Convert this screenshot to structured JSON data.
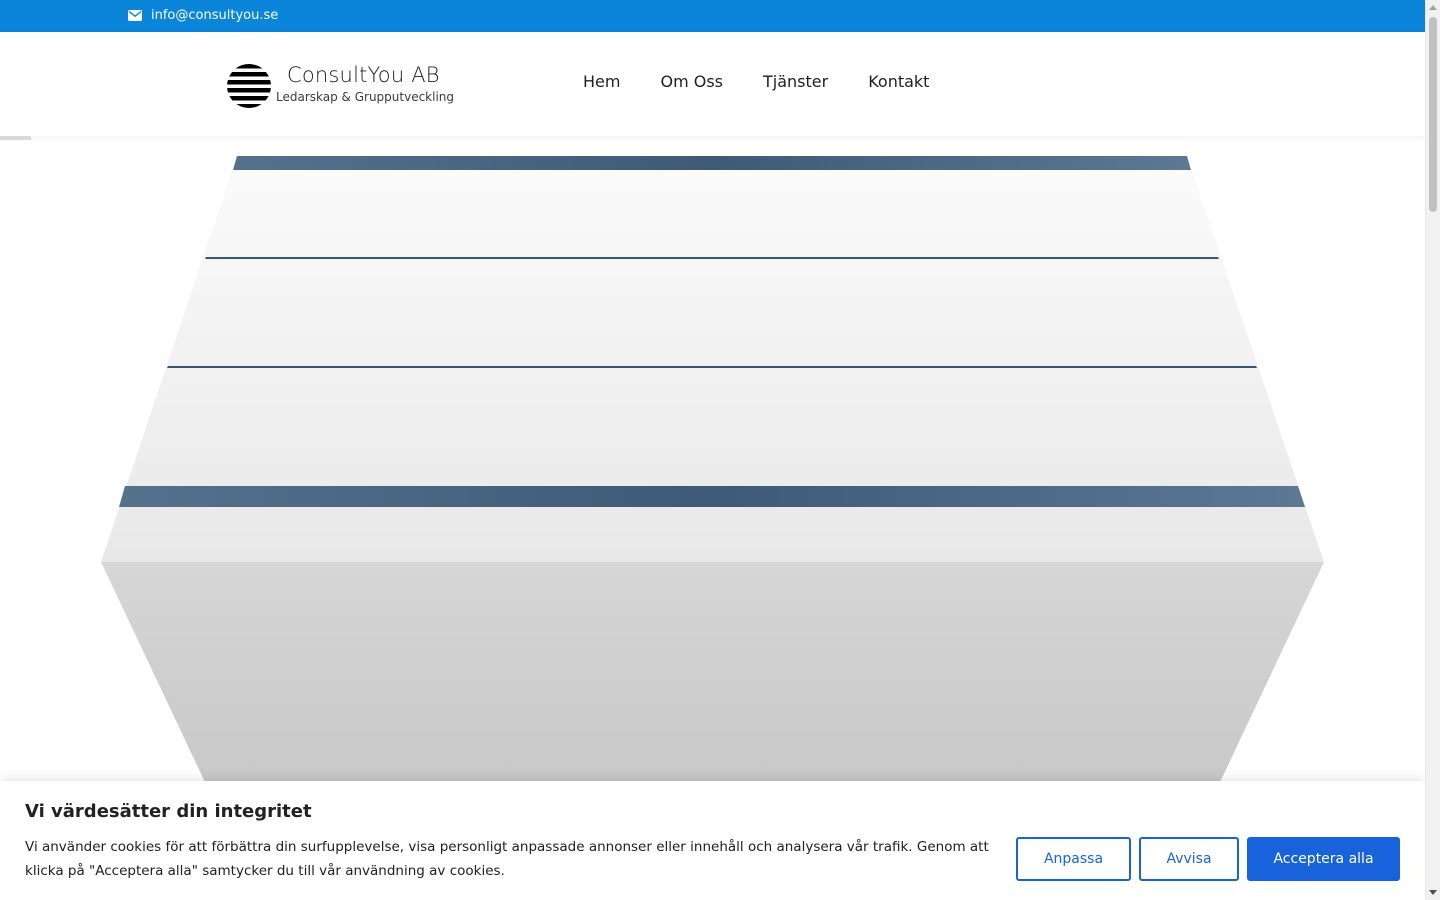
{
  "topbar": {
    "email": "info@consultyou.se",
    "icon": "envelope-icon"
  },
  "logo": {
    "name": "ConsultYou AB",
    "tagline": "Ledarskap & Grupputveckling"
  },
  "nav": {
    "items": [
      "Hem",
      "Om Oss",
      "Tjänster",
      "Kontakt"
    ]
  },
  "cookie_banner": {
    "title": "Vi värdesätter din integritet",
    "text": "Vi använder cookies för att förbättra din surfupplevelse, visa personligt anpassade annonser eller innehåll och analysera vår trafik. Genom att klicka på \"Acceptera alla\" samtycker du till vår användning av cookies.",
    "customize_label": "Anpassa",
    "reject_label": "Avvisa",
    "accept_label": "Acceptera alla"
  },
  "colors": {
    "topbar": "#0a85d9",
    "button_blue": "#1863dc",
    "hero_stripe": "#4e6a85"
  }
}
